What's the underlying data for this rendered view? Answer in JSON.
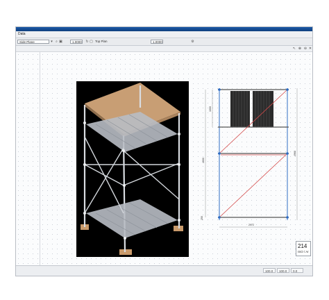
{
  "window": {
    "menu_label": "Data"
  },
  "toolbar": {
    "view_combo": "Side Plane",
    "value_field": "1.0000",
    "layer_combo": "Top Plan",
    "elev_combo": "1.0000"
  },
  "drawing": {
    "dim_bottom_width": "2972",
    "dim_total_height": "4960",
    "dim_mid_height": "4000",
    "dim_top_height": "1000",
    "dim_bottom_height": "250"
  },
  "badge": {
    "number": "214",
    "sub": "ISO / Ar"
  },
  "status": {
    "cell1": "100.0",
    "cell2": "100.0",
    "cell3": "0.0"
  },
  "colors": {
    "deck": "#c99a6b",
    "render_bg": "#000000",
    "dim_red": "#d44a4a",
    "frame_blue": "#2c6bc4"
  }
}
